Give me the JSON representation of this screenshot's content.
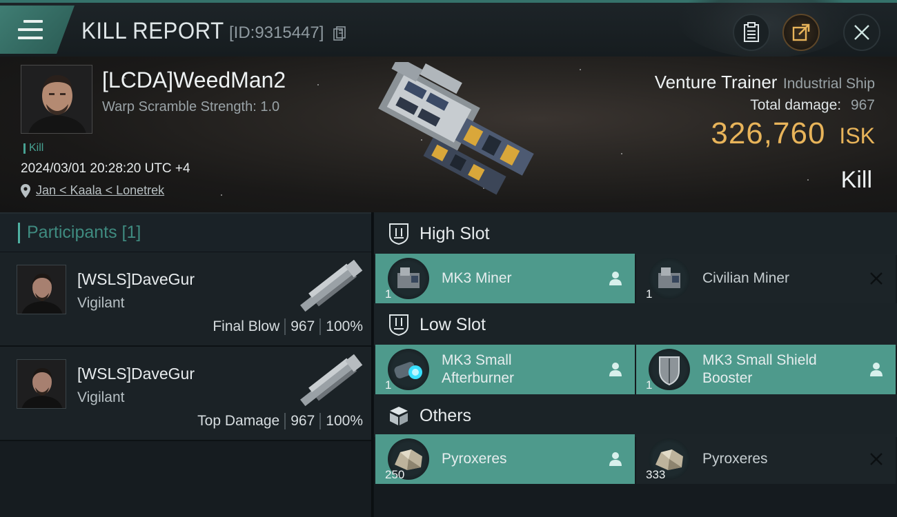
{
  "header": {
    "title": "KILL REPORT",
    "report_id": "[ID:9315447]"
  },
  "victim": {
    "name": "[LCDA]WeedMan2",
    "warp_scramble": "Warp Scramble Strength: 1.0",
    "kill_tag": "Kill",
    "timestamp": "2024/03/01 20:28:20 UTC +4",
    "location": "Jan < Kaala < Lonetrek"
  },
  "ship": {
    "name": "Venture Trainer",
    "class": "Industrial Ship",
    "total_damage_label": "Total damage:",
    "total_damage": "967",
    "isk_value": "326,760",
    "isk_unit": "ISK",
    "result": "Kill"
  },
  "participants": {
    "label": "Participants [1]",
    "rows": [
      {
        "name": "[WSLS]DaveGur",
        "ship": "Vigilant",
        "role": "Final Blow",
        "damage": "967",
        "percent": "100%"
      },
      {
        "name": "[WSLS]DaveGur",
        "ship": "Vigilant",
        "role": "Top Damage",
        "damage": "967",
        "percent": "100%"
      }
    ]
  },
  "slots": {
    "high": {
      "title": "High Slot",
      "items": [
        {
          "name": "MK3 Miner",
          "qty": "1",
          "status": "dropped"
        },
        {
          "name": "Civilian Miner",
          "qty": "1",
          "status": "destroyed"
        }
      ]
    },
    "low": {
      "title": "Low Slot",
      "items": [
        {
          "name": "MK3 Small Afterburner",
          "line1": "MK3 Small",
          "line2": "Afterburner",
          "qty": "1",
          "status": "dropped"
        },
        {
          "name": "MK3 Small Shield Booster",
          "line1": "MK3 Small Shield",
          "line2": "Booster",
          "qty": "1",
          "status": "dropped"
        }
      ]
    },
    "others": {
      "title": "Others",
      "items": [
        {
          "name": "Pyroxeres",
          "qty": "250",
          "status": "dropped"
        },
        {
          "name": "Pyroxeres",
          "qty": "333",
          "status": "destroyed"
        }
      ]
    }
  },
  "colors": {
    "accent": "#4e9a8c",
    "isk": "#e8b45a",
    "teal_text": "#3f8b80"
  },
  "icons": {
    "menu": "hamburger-menu-icon",
    "copy": "copy-icon",
    "clipboard": "clipboard-icon",
    "share": "share-icon",
    "close": "close-icon",
    "location": "location-pin-icon",
    "high_slot": "high-slot-icon",
    "low_slot": "low-slot-icon",
    "others": "cargo-box-icon",
    "dropped": "person-icon",
    "destroyed": "x-icon"
  }
}
